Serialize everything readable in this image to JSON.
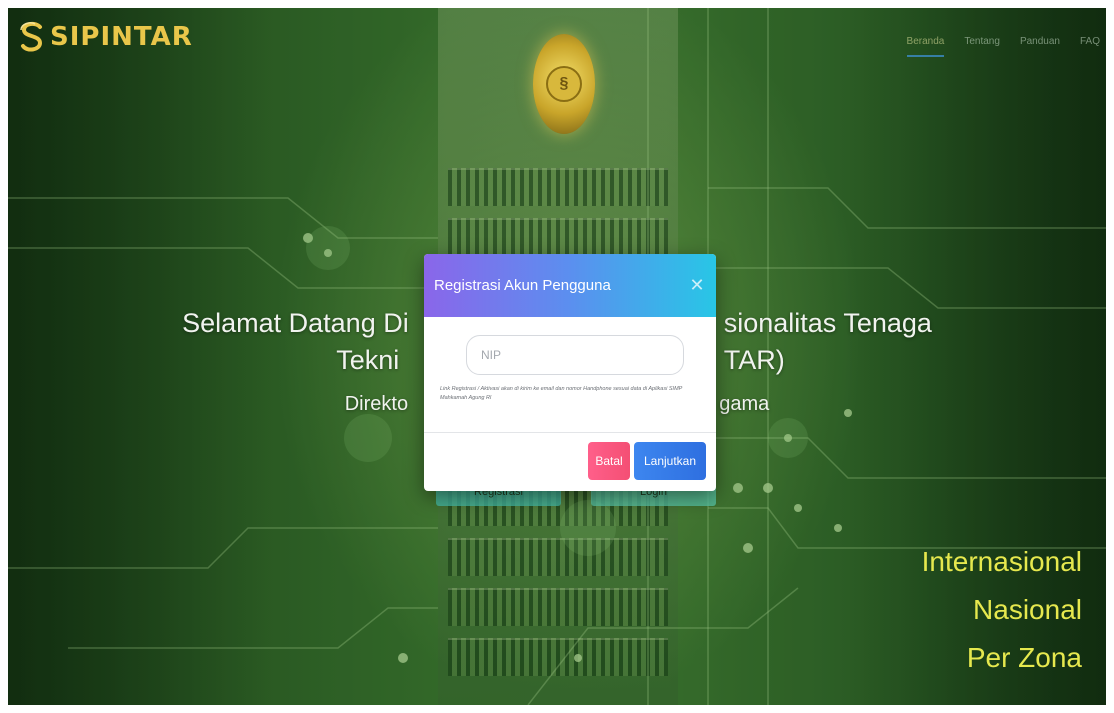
{
  "header": {
    "logo_text": "SIPINTAR",
    "logo_icon": "sipintar-s-logo-icon",
    "emblem_icon": "emblem-seal-icon",
    "nav": [
      {
        "label": "Beranda",
        "active": true
      },
      {
        "label": "Tentang",
        "active": false
      },
      {
        "label": "Panduan",
        "active": false
      },
      {
        "label": "FAQ",
        "active": false
      }
    ]
  },
  "hero": {
    "line1_left": "Selamat Datang Di",
    "line1_right": "sionalitas Tenaga",
    "line2_left": "Tekni",
    "line2_right": "TAR)",
    "line3_left": "Direkto",
    "line3_right": "gama",
    "register_button": "Registrasi",
    "login_button": "Login"
  },
  "taglines": [
    "Internasional",
    "Nasional",
    "Per Zona"
  ],
  "modal": {
    "title": "Registrasi Akun Pengguna",
    "close_icon": "close-x-icon",
    "nip_placeholder": "NIP",
    "note": "Link Registrasi / Aktivasi akan di kirim ke email dan nomor Handphone sesuai data di Aplikasi SIMP Mahkamah Agung RI",
    "cancel_label": "Batal",
    "continue_label": "Lanjutkan"
  },
  "colors": {
    "background_green": "#3c7a30",
    "logo_gold": "#e9c64a",
    "tagline_yellow": "#e6e84e",
    "modal_header_start": "#8a66ea",
    "modal_header_end": "#28c6e6",
    "cancel_button": "#f44f74",
    "continue_button": "#2e6fe0"
  }
}
